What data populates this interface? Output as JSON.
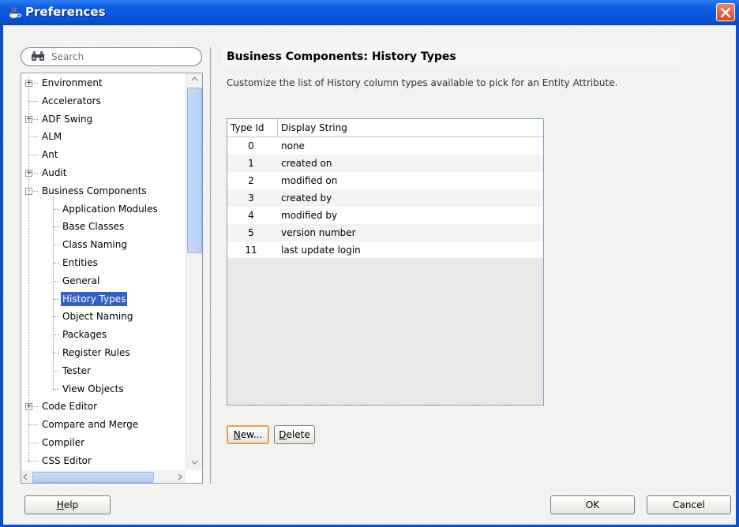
{
  "window": {
    "title": "Preferences"
  },
  "search": {
    "placeholder": "Search"
  },
  "tree": {
    "items": [
      {
        "label": "Environment",
        "level": 0,
        "expander": "+"
      },
      {
        "label": "Accelerators",
        "level": 0,
        "expander": ""
      },
      {
        "label": "ADF Swing",
        "level": 0,
        "expander": "+"
      },
      {
        "label": "ALM",
        "level": 0,
        "expander": ""
      },
      {
        "label": "Ant",
        "level": 0,
        "expander": ""
      },
      {
        "label": "Audit",
        "level": 0,
        "expander": "+"
      },
      {
        "label": "Business Components",
        "level": 0,
        "expander": "-"
      },
      {
        "label": "Application Modules",
        "level": 1,
        "expander": ""
      },
      {
        "label": "Base Classes",
        "level": 1,
        "expander": ""
      },
      {
        "label": "Class Naming",
        "level": 1,
        "expander": ""
      },
      {
        "label": "Entities",
        "level": 1,
        "expander": ""
      },
      {
        "label": "General",
        "level": 1,
        "expander": ""
      },
      {
        "label": "History Types",
        "level": 1,
        "expander": "",
        "selected": true
      },
      {
        "label": "Object Naming",
        "level": 1,
        "expander": ""
      },
      {
        "label": "Packages",
        "level": 1,
        "expander": ""
      },
      {
        "label": "Register Rules",
        "level": 1,
        "expander": ""
      },
      {
        "label": "Tester",
        "level": 1,
        "expander": ""
      },
      {
        "label": "View Objects",
        "level": 1,
        "expander": ""
      },
      {
        "label": "Code Editor",
        "level": 0,
        "expander": "+"
      },
      {
        "label": "Compare and Merge",
        "level": 0,
        "expander": ""
      },
      {
        "label": "Compiler",
        "level": 0,
        "expander": ""
      },
      {
        "label": "CSS Editor",
        "level": 0,
        "expander": ""
      }
    ]
  },
  "panel": {
    "title": "Business Components: History Types",
    "description": "Customize the list of History column types available to pick for an Entity Attribute."
  },
  "table": {
    "columns": [
      "Type Id",
      "Display String"
    ],
    "rows": [
      [
        "0",
        "none"
      ],
      [
        "1",
        "created on"
      ],
      [
        "2",
        "modified on"
      ],
      [
        "3",
        "created by"
      ],
      [
        "4",
        "modified by"
      ],
      [
        "5",
        "version number"
      ],
      [
        "11",
        "last update login"
      ]
    ]
  },
  "buttons": {
    "new_mnemonic": "N",
    "new_rest": "ew...",
    "delete_mnemonic": "D",
    "delete_rest": "elete",
    "help_mnemonic": "H",
    "help_rest": "elp",
    "ok": "OK",
    "cancel": "Cancel"
  },
  "colors": {
    "titlebar": "#0654d8",
    "selection": "#3161c6",
    "focus_border": "#e8a14c",
    "close_button": "#d6481f"
  }
}
